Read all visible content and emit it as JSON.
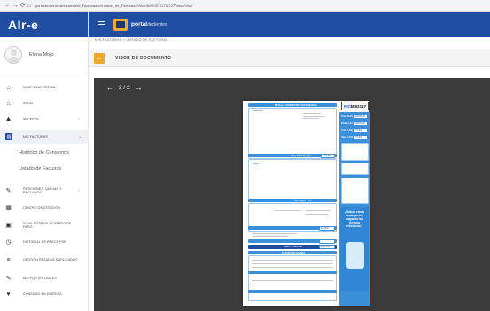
{
  "browser": {
    "nav_glyphs": "← → ⟳ ⌂",
    "url": "portaldecliente.aire.com/Aire_Facturacion/Listado_de_Facturas#/Visor/AIRE/6111711127/Visor/Visor"
  },
  "app": {
    "logo_text": "AIr-e",
    "portal_name": "portal",
    "portal_sub": "declientes"
  },
  "user": {
    "name": "Elena Mojo"
  },
  "sidebar": {
    "items": [
      {
        "label": "Mi oficina virtual",
        "icon": "home-icon"
      },
      {
        "label": "Inicio",
        "icon": "home-icon"
      },
      {
        "label": "Mi perfil",
        "icon": "user-icon"
      },
      {
        "label": "Mis facturas",
        "icon": "invoice-icon"
      },
      {
        "label": "Peticiones, quejas y reclamos",
        "icon": "pencil-icon"
      },
      {
        "label": "Centro de atención",
        "icon": "calendar-icon"
      },
      {
        "label": "Simulador de acuerdo de pago",
        "icon": "calculator-icon"
      },
      {
        "label": "Historial de pagos PSE",
        "icon": "clock-icon"
      },
      {
        "label": "Gestión pagadas duplicadas",
        "icon": "list-icon"
      },
      {
        "label": "Mis PQR virtuales",
        "icon": "pencil-icon"
      },
      {
        "label": "Consumo en energía",
        "icon": "heart-icon"
      }
    ],
    "subitems": [
      "Histórico de Consumos",
      "Listado de Facturas"
    ]
  },
  "breadcrumb": "MIS FACTURAS  >  LISTADO DE FACTURAS",
  "viewer": {
    "title": "VISOR DE DOCUMENTO",
    "page_indicator": "2 / 2"
  },
  "document": {
    "nic_label": "NIC:",
    "nic_value": "6892157",
    "left_headers": [
      "DETALLE CONCEPTOS FACTURADOS",
      "ENERGÍA",
      "ASEO",
      "Valor Total Energía",
      "Valor Total Aseo",
      "TOTAL A PAGAR",
      "ESTADO DE CUENTA"
    ],
    "totals": [
      "$ 34.700",
      "$ 1.500",
      "$ 37.000"
    ],
    "right_labels": [
      "Total Factura",
      "Fecha Límite",
      "Total a Pagar",
      "Valor a Pagar"
    ],
    "right_values": [
      "14/02/2022",
      "14/02/2022",
      "$ 37.000",
      "$ 37.000"
    ],
    "ad_text": "¿Sabes cómo proteger tus hogar de los riesgos eléctricos?"
  },
  "colors": {
    "brand_blue": "#1e4da1",
    "accent_orange": "#f0a72a",
    "doc_blue": "#3c8fd9",
    "viewer_bg": "#3b3b3b"
  }
}
